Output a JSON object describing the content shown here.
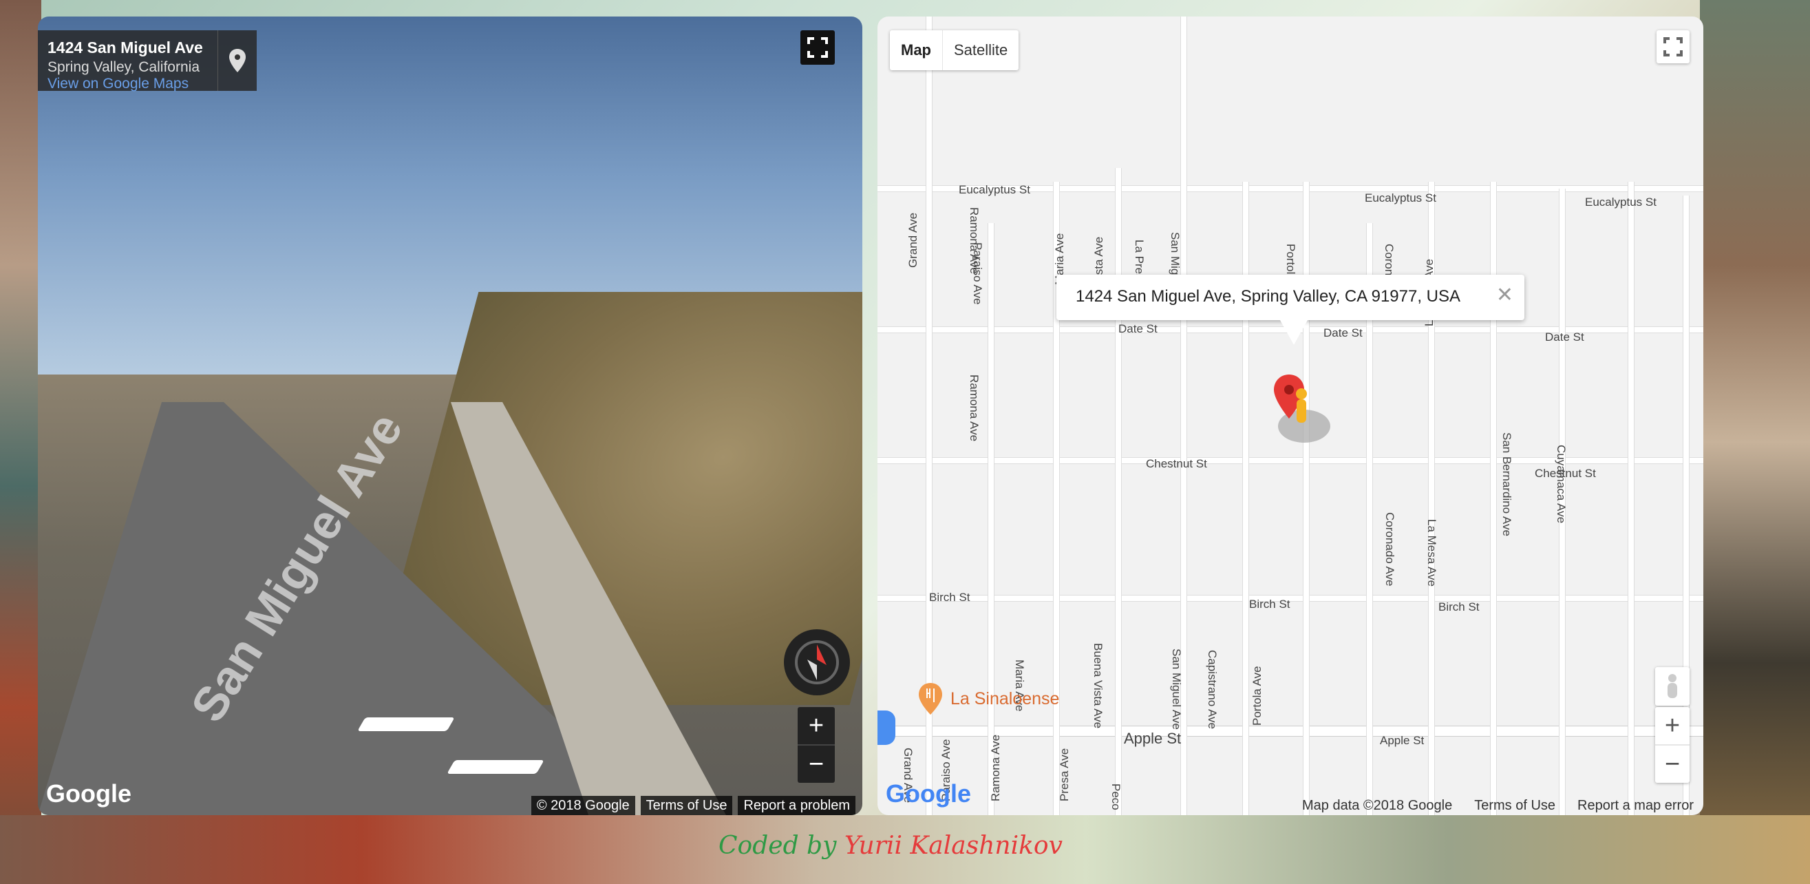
{
  "streetview": {
    "address_title": "1424 San Miguel Ave",
    "address_sub": "Spring Valley, California",
    "link": "View on Google Maps",
    "street_name": "San Miguel Ave",
    "logo": "Google",
    "footer": [
      "© 2018 Google",
      "Terms of Use",
      "Report a problem"
    ],
    "zoom_in": "+",
    "zoom_out": "−",
    "icons": {
      "pin": "location-pin-icon",
      "fullscreen": "fullscreen-icon",
      "compass": "compass-icon"
    }
  },
  "map": {
    "type_tabs": [
      {
        "label": "Map"
      },
      {
        "label": "Satellite"
      }
    ],
    "popup_text": "1424 San Miguel Ave, Spring Valley, CA 91977, USA",
    "popup_close": "✕",
    "poi_label": "La Sinaloense",
    "streets": {
      "eucalyptus_1": "Eucalyptus St",
      "eucalyptus_2": "Eucalyptus St",
      "eucalyptus_3": "Eucalyptus St",
      "date_1": "Date St",
      "date_2": "Date St",
      "date_3": "Date St",
      "chestnut_1": "Chestnut St",
      "chestnut_2": "Chestnut St",
      "birch_1": "Birch St",
      "birch_2": "Birch St",
      "birch_3": "Birch St",
      "apple_1": "Apple St",
      "apple_2": "Apple St",
      "grand_1": "Grand Ave",
      "grand_2": "Grand Ave",
      "paraiso_1": "Paraiso Ave",
      "paraiso_2": "Paraiso Ave",
      "ramona_1": "Ramona Ave",
      "ramona_2": "Ramona Ave",
      "ramona_3": "Ramona Ave",
      "maria_1": "Maria Ave",
      "maria_2": "Maria Ave",
      "vista_1": "Vista Ave",
      "buena_vista": "Buena Vista Ave",
      "la_presa_1": "La Presa",
      "la_presa_2": "Presa Ave",
      "san_miguel_1": "San Miguel",
      "san_miguel_2": "San Miguel Ave",
      "capistrano": "Capistrano Ave",
      "portola_1": "Portola",
      "portola_2": "Portola Ave",
      "coronado_1": "Coronado",
      "coronado_2": "Coronado Ave",
      "la_mesa_1": "La Mesa Ave",
      "la_mesa_2": "La Mesa Ave",
      "san_bernardino": "San Bernardino Ave",
      "cuyamaca": "Cuyamaca Ave",
      "peco": "Peco"
    },
    "logo": "Google",
    "footer": [
      "Map data ©2018 Google",
      "Terms of Use",
      "Report a map error"
    ],
    "zoom_in": "+",
    "zoom_out": "−"
  },
  "credit": {
    "part1": "Coded by",
    "part2": "Yurii Kalashnikov"
  },
  "colors": {
    "marker": "#e53935",
    "pegman": "#f5b321",
    "credit_green": "#2e9a45",
    "credit_red": "#e53b3b"
  }
}
